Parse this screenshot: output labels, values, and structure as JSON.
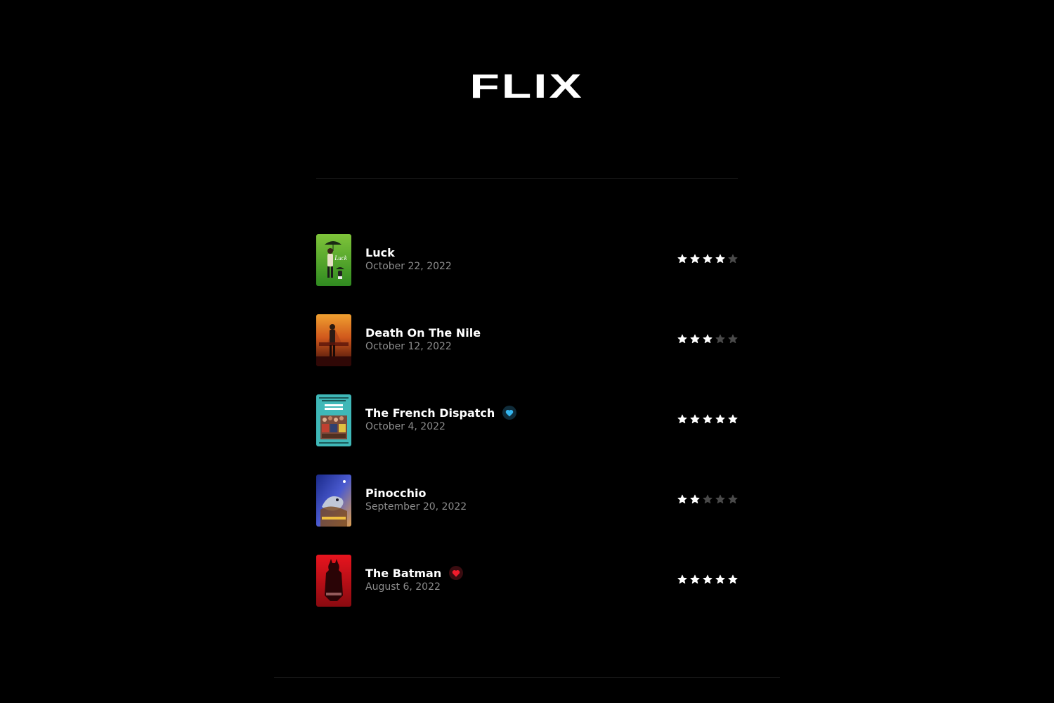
{
  "brand": {
    "logo_text": "FLIX"
  },
  "colors": {
    "background": "#000000",
    "star_on": "#ffffff",
    "star_off": "#4a4a4a",
    "heart_blue": "#35b6f0",
    "heart_blue_bg": "#0f2c3a",
    "heart_red": "#f01c2c",
    "heart_red_bg": "#3a0c10"
  },
  "movies": [
    {
      "title": "Luck",
      "date": "October 22, 2022",
      "rating": 4,
      "max_rating": 5,
      "heart": null,
      "poster_icon": "luck-poster"
    },
    {
      "title": "Death On The Nile",
      "date": "October 12, 2022",
      "rating": 3,
      "max_rating": 5,
      "heart": null,
      "poster_icon": "death-on-the-nile-poster"
    },
    {
      "title": "The French Dispatch",
      "date": "October 4, 2022",
      "rating": 5,
      "max_rating": 5,
      "heart": "blue",
      "poster_icon": "french-dispatch-poster"
    },
    {
      "title": "Pinocchio",
      "date": "September 20, 2022",
      "rating": 2,
      "max_rating": 5,
      "heart": null,
      "poster_icon": "pinocchio-poster"
    },
    {
      "title": "The Batman",
      "date": "August 6, 2022",
      "rating": 5,
      "max_rating": 5,
      "heart": "red",
      "poster_icon": "the-batman-poster"
    }
  ]
}
